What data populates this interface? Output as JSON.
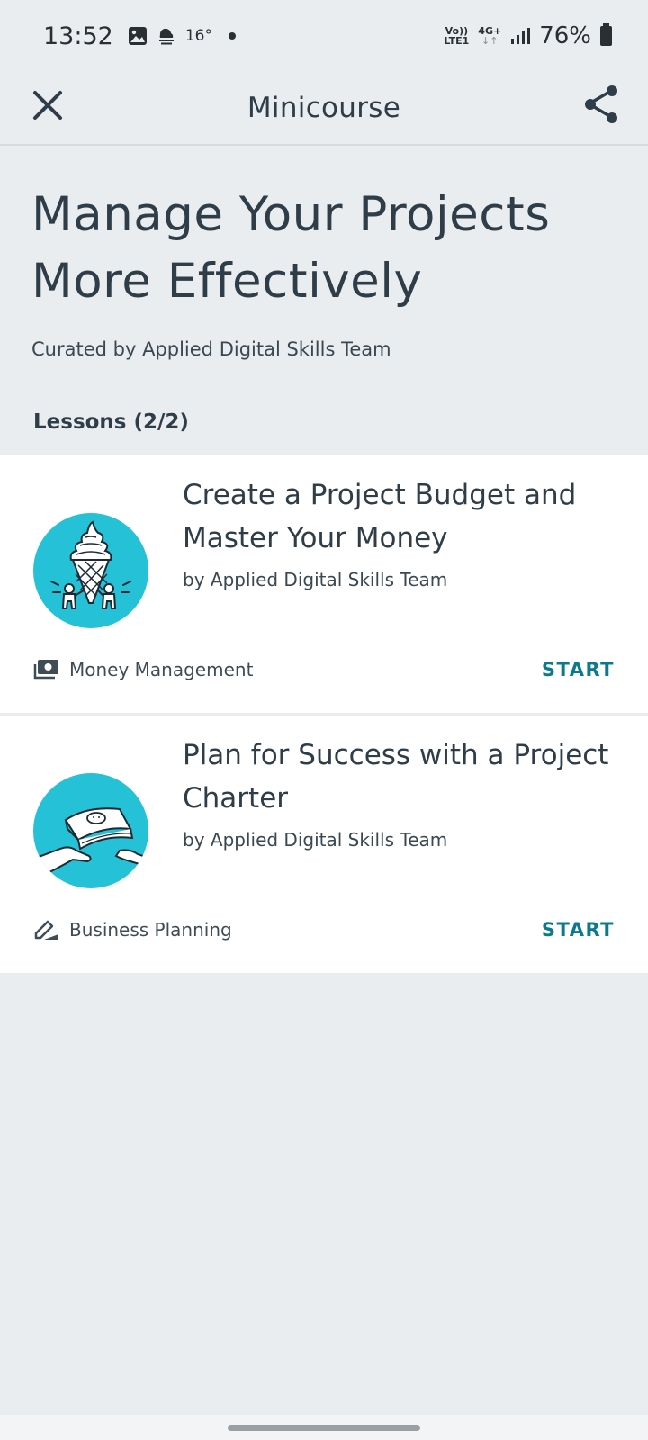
{
  "status_bar": {
    "time": "13:52",
    "temperature": "16°",
    "net_top": "Vo))",
    "net_bottom": "LTE1",
    "net_gen": "4G+",
    "battery": "76%"
  },
  "app_bar": {
    "title": "Minicourse"
  },
  "course": {
    "title_line1": "Manage Your Projects",
    "title_line2": "More Effectively",
    "curated_by": "Curated by Applied Digital Skills Team",
    "lessons_label": "Lessons (2/2)"
  },
  "lessons": [
    {
      "title": "Create a Project Budget and Master Your Money",
      "author": "by Applied Digital Skills Team",
      "category": "Money Management",
      "action": "START",
      "category_icon": "money-icon",
      "thumbnail": "ice-cream-illustration"
    },
    {
      "title": "Plan for Success with a Project Charter",
      "author": "by Applied Digital Skills Team",
      "category": "Business Planning",
      "action": "START",
      "category_icon": "pen-icon",
      "thumbnail": "book-handoff-illustration"
    }
  ],
  "colors": {
    "background": "#eaedf0",
    "card": "#ffffff",
    "accent": "#0b7a8c",
    "thumbnail_bg": "#25c1d6",
    "text": "#2e3d48"
  }
}
